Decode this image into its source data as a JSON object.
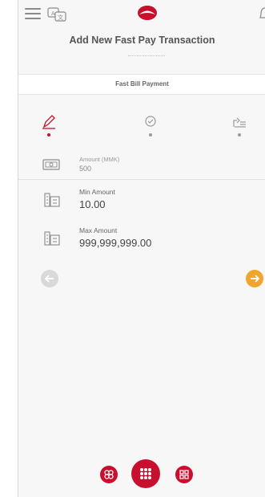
{
  "header": {
    "title": "Add New Fast Pay Transaction"
  },
  "sub_header": {
    "label": "Fast Bill Payment"
  },
  "steps": [
    {
      "icon": "pencil-icon",
      "active": true
    },
    {
      "icon": "check-circle-icon",
      "active": false
    },
    {
      "icon": "share-icon",
      "active": false
    }
  ],
  "amount_field": {
    "label": "Amount (MMK)",
    "value": "500",
    "icon": "money-icon"
  },
  "limits": {
    "min_label": "Min Amount",
    "min_value": "10.00",
    "max_label": "Max Amount",
    "max_value": "999,999,999.00"
  },
  "colors": {
    "brand_red": "#c8102e",
    "next_orange": "#f2a52e",
    "back_grey": "#d9d9d9",
    "background": "#f7f7f7"
  },
  "nav": {
    "left_icon": "apps-icon",
    "center_icon": "grid-icon",
    "right_icon": "services-icon"
  }
}
